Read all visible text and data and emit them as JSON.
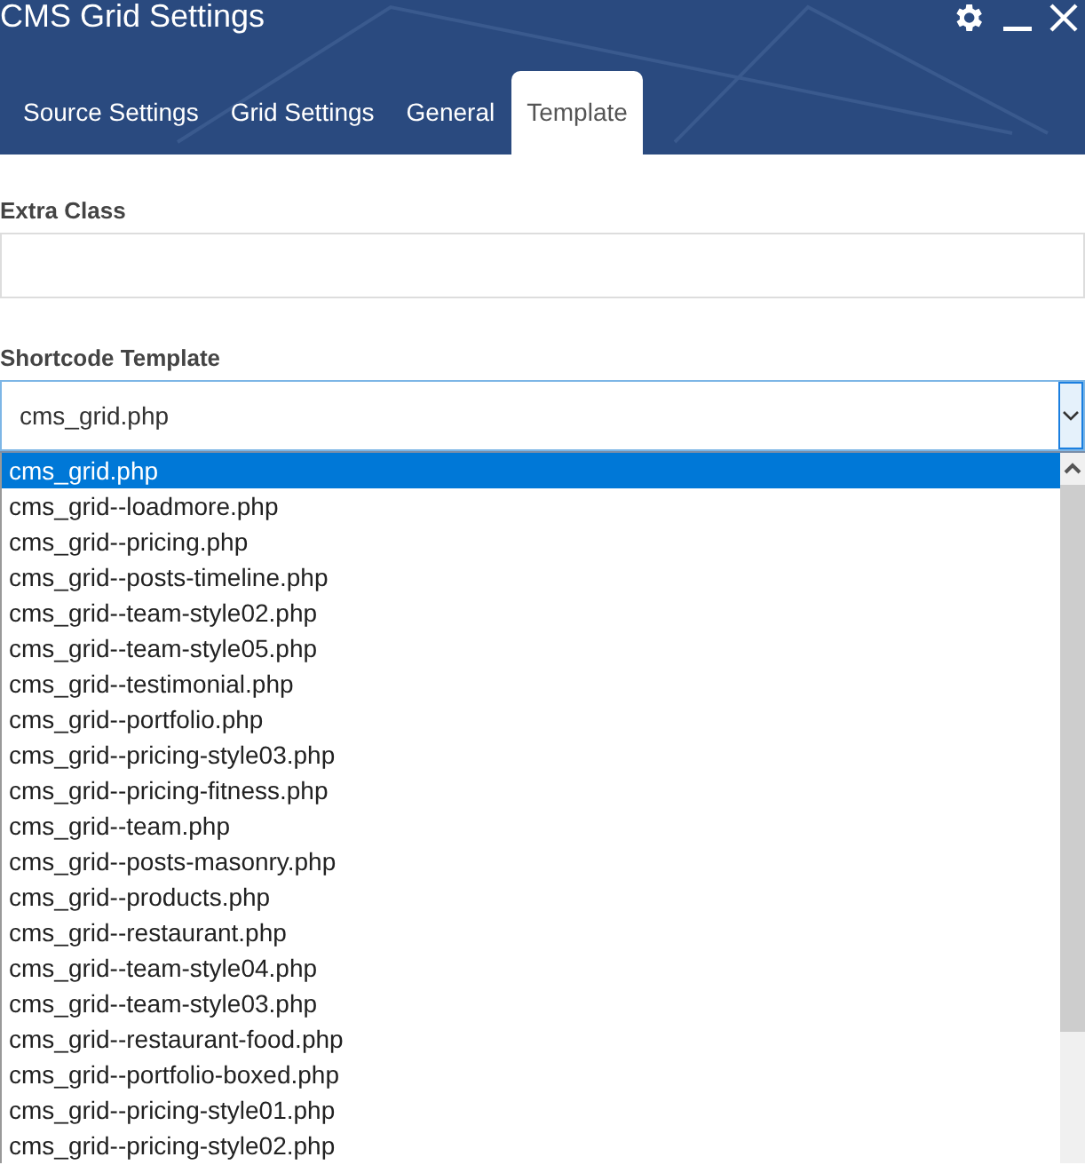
{
  "window": {
    "title": "CMS Grid Settings"
  },
  "tabs": [
    {
      "label": "Source Settings",
      "selected": false
    },
    {
      "label": "Grid Settings",
      "selected": false
    },
    {
      "label": "General",
      "selected": false
    },
    {
      "label": "Template",
      "selected": true
    }
  ],
  "fields": [
    {
      "label": "Extra Class"
    }
  ],
  "shortcode_template": {
    "label": "Shortcode Template",
    "value": "cms_grid.php",
    "expanded": true,
    "options": [
      {
        "label": "cms_grid.php",
        "selected": true
      },
      {
        "label": "cms_grid--loadmore.php",
        "selected": false
      },
      {
        "label": "cms_grid--pricing.php",
        "selected": false
      },
      {
        "label": "cms_grid--posts-timeline.php",
        "selected": false
      },
      {
        "label": "cms_grid--team-style02.php",
        "selected": false
      },
      {
        "label": "cms_grid--team-style05.php",
        "selected": false
      },
      {
        "label": "cms_grid--testimonial.php",
        "selected": false
      },
      {
        "label": "cms_grid--portfolio.php",
        "selected": false
      },
      {
        "label": "cms_grid--pricing-style03.php",
        "selected": false
      },
      {
        "label": "cms_grid--pricing-fitness.php",
        "selected": false
      },
      {
        "label": "cms_grid--team.php",
        "selected": false
      },
      {
        "label": "cms_grid--posts-masonry.php",
        "selected": false
      },
      {
        "label": "cms_grid--products.php",
        "selected": false
      },
      {
        "label": "cms_grid--restaurant.php",
        "selected": false
      },
      {
        "label": "cms_grid--team-style04.php",
        "selected": false
      },
      {
        "label": "cms_grid--team-style03.php",
        "selected": false
      },
      {
        "label": "cms_grid--restaurant-food.php",
        "selected": false
      },
      {
        "label": "cms_grid--portfolio-boxed.php",
        "selected": false
      },
      {
        "label": "cms_grid--pricing-style01.php",
        "selected": false
      },
      {
        "label": "cms_grid--pricing-style02.php",
        "selected": false
      }
    ]
  }
}
